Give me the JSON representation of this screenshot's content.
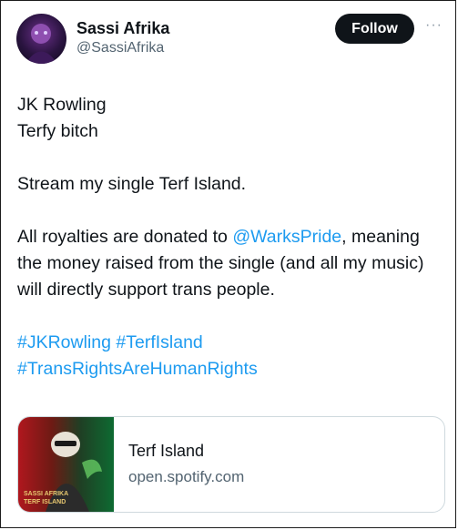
{
  "author": {
    "name": "Sassi Afrika",
    "handle": "@SassiAfrika",
    "avatar_icon": "profile-avatar"
  },
  "actions": {
    "follow_label": "Follow",
    "more_icon": "ellipsis-icon"
  },
  "tweet": {
    "line1": "JK Rowling",
    "line2": "Terfy bitch",
    "line3": "Stream my single Terf Island.",
    "p3_prefix": "All royalties are donated to ",
    "mention": "@WarksPride",
    "p3_suffix": ", meaning the money raised from the single (and all my music) will directly support trans people.",
    "hashtag1": "#JKRowling",
    "hashtag2": "#TerfIsland",
    "hashtag3": "#TransRightsAreHumanRights"
  },
  "link_card": {
    "title": "Terf Island",
    "domain": "open.spotify.com",
    "thumb_line1": "SASSI AFRIKA",
    "thumb_line2": "TERF ISLAND"
  },
  "colors": {
    "link": "#1d9bf0",
    "text": "#0f1419",
    "muted": "#536471",
    "follow_bg": "#0f1419"
  }
}
